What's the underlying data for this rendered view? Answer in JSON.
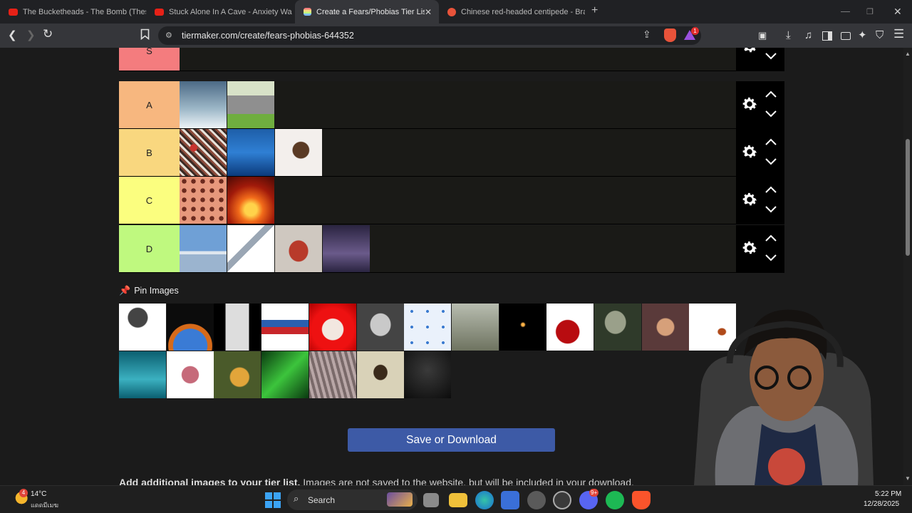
{
  "browser": {
    "tabs": [
      {
        "title": "The Bucketheads - The Bomb (These",
        "favicon": "youtube-icon"
      },
      {
        "title": "Stuck Alone In A Cave - Anxiety Warn",
        "favicon": "youtube-icon"
      },
      {
        "title": "Create a Fears/Phobias Tier List",
        "favicon": "tiermaker-icon",
        "active": true
      },
      {
        "title": "Chinese red-headed centipede - Brav",
        "favicon": "brave-search-icon"
      }
    ],
    "url": "tiermaker.com/create/fears-phobias-644352",
    "notification_badge": "1"
  },
  "tiers": [
    {
      "label": "S",
      "color": "#f47c7e",
      "items": []
    },
    {
      "label": "A",
      "color": "#f7b77f",
      "items": [
        "shark",
        "gravestone"
      ]
    },
    {
      "label": "B",
      "color": "#f9d77f",
      "items": [
        "crowd",
        "ocean",
        "tarantula"
      ]
    },
    {
      "label": "C",
      "color": "#fbfe7f",
      "items": [
        "holes-trypophobia",
        "house-fire"
      ]
    },
    {
      "label": "D",
      "color": "#bff97f",
      "items": [
        "airplane",
        "syringe",
        "puppet",
        "lightning"
      ]
    }
  ],
  "pin_images": {
    "label": "Pin Images",
    "items": [
      "microphone",
      "asteroid-earth",
      "window-silhouette",
      "knotted-rope",
      "clown",
      "man-portrait",
      "virus",
      "height-view",
      "candle-darkness",
      "blood",
      "alien",
      "scared-girl",
      "cockroach",
      "sea-creature",
      "worm",
      "lizard",
      "green-snake",
      "centipede",
      "scorpion",
      "dark-fog"
    ]
  },
  "save_button": "Save or Download",
  "add_images_text": {
    "bold": "Add additional images to your tier list.",
    "rest": " Images are not saved to the website, but will be included in your download."
  },
  "taskbar": {
    "weather_temp": "14°C",
    "weather_desc": "แดดมีเมฆ",
    "weather_badge": "4",
    "search_label": "Search",
    "time": "5:22 PM",
    "date": "12/28/2025",
    "discord_badge": "9+"
  }
}
